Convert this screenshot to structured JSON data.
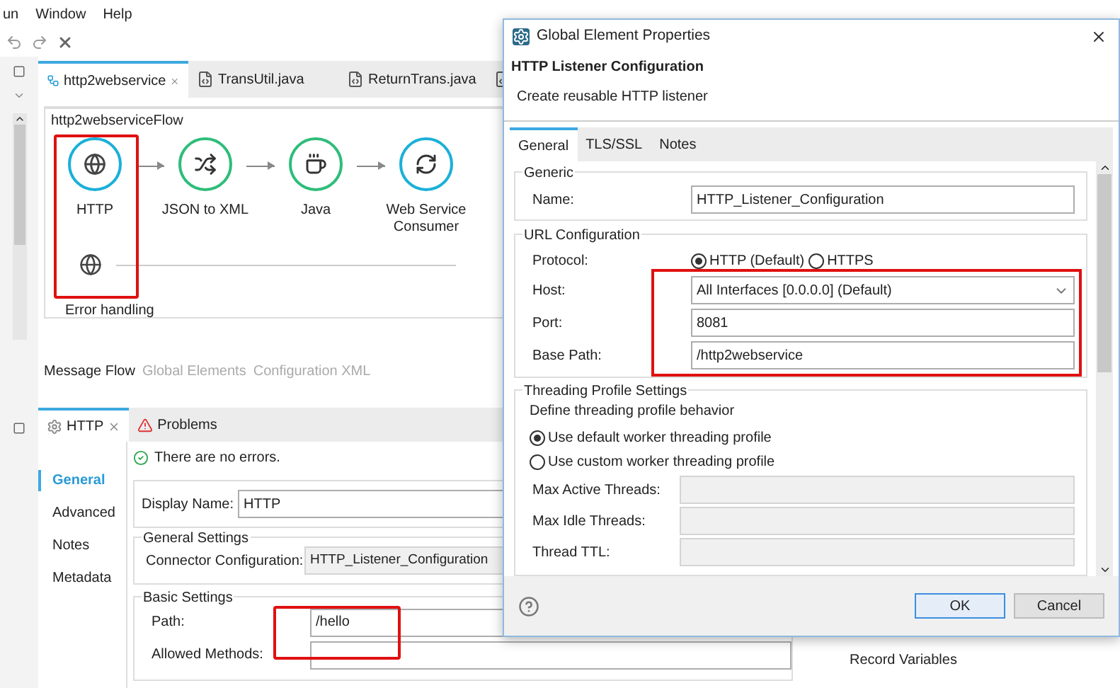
{
  "menu": [
    "un",
    "Window",
    "Help"
  ],
  "editor_tabs": [
    {
      "label": "http2webservice",
      "selected": true,
      "kind": "flow"
    },
    {
      "label": "TransUtil.java",
      "selected": false,
      "kind": "java"
    },
    {
      "label": "ReturnTrans.java",
      "selected": false,
      "kind": "java"
    }
  ],
  "flow": {
    "title": "http2webserviceFlow",
    "nodes": [
      {
        "label": "HTTP",
        "kind": "http"
      },
      {
        "label": "JSON to XML",
        "kind": "transform"
      },
      {
        "label": "Java",
        "kind": "java"
      },
      {
        "label": "Web Service Consumer",
        "kind": "service"
      }
    ],
    "error_handling": "Error handling"
  },
  "view_tabs": [
    {
      "label": "Message Flow",
      "selected": true
    },
    {
      "label": "Global Elements",
      "selected": false
    },
    {
      "label": "Configuration XML",
      "selected": false
    }
  ],
  "properties": {
    "tabs": [
      {
        "label": "HTTP",
        "selected": true,
        "kind": "gear"
      },
      {
        "label": "Problems",
        "selected": false,
        "kind": "problems"
      }
    ],
    "nav": [
      {
        "label": "General",
        "selected": true
      },
      {
        "label": "Advanced",
        "selected": false
      },
      {
        "label": "Notes",
        "selected": false
      },
      {
        "label": "Metadata",
        "selected": false
      }
    ],
    "status": "There are no errors.",
    "display_name": {
      "label": "Display Name:",
      "value": "HTTP"
    },
    "general_settings": {
      "title": "General Settings",
      "label": "Connector Configuration:",
      "value": "HTTP_Listener_Configuration"
    },
    "basic_settings": {
      "title": "Basic Settings",
      "fields": [
        {
          "label": "Path:",
          "value": "/hello"
        },
        {
          "label": "Allowed Methods:"
        }
      ]
    }
  },
  "right_list": [
    "Record Variables"
  ],
  "dialog": {
    "title": "Global Element Properties",
    "heading": "HTTP Listener Configuration",
    "subtitle": "Create reusable HTTP listener",
    "tabs": [
      {
        "label": "General",
        "selected": true
      },
      {
        "label": "TLS/SSL",
        "selected": false
      },
      {
        "label": "Notes",
        "selected": false
      }
    ],
    "generic": {
      "title": "Generic",
      "label": "Name:",
      "value": "HTTP_Listener_Configuration"
    },
    "url": {
      "title": "URL Configuration",
      "protocol_label": "Protocol:",
      "protocol_options": [
        {
          "label": "HTTP (Default)",
          "selected": true
        },
        {
          "label": "HTTPS",
          "selected": false
        }
      ],
      "host": {
        "label": "Host:",
        "value": "All Interfaces [0.0.0.0] (Default)"
      },
      "port": {
        "label": "Port:",
        "value": "8081"
      },
      "base_path": {
        "label": "Base Path:",
        "value": "/http2webservice"
      }
    },
    "threading": {
      "title": "Threading Profile Settings",
      "description": "Define threading profile behavior",
      "options": [
        {
          "label": "Use default worker threading profile",
          "selected": true
        },
        {
          "label": "Use custom worker threading profile",
          "selected": false
        }
      ],
      "fields": [
        {
          "label": "Max Active Threads:"
        },
        {
          "label": "Max Idle Threads:"
        },
        {
          "label": "Thread TTL:"
        }
      ]
    },
    "buttons": [
      {
        "label": "OK",
        "kind": "primary"
      },
      {
        "label": "Cancel",
        "kind": "secondary"
      }
    ]
  }
}
